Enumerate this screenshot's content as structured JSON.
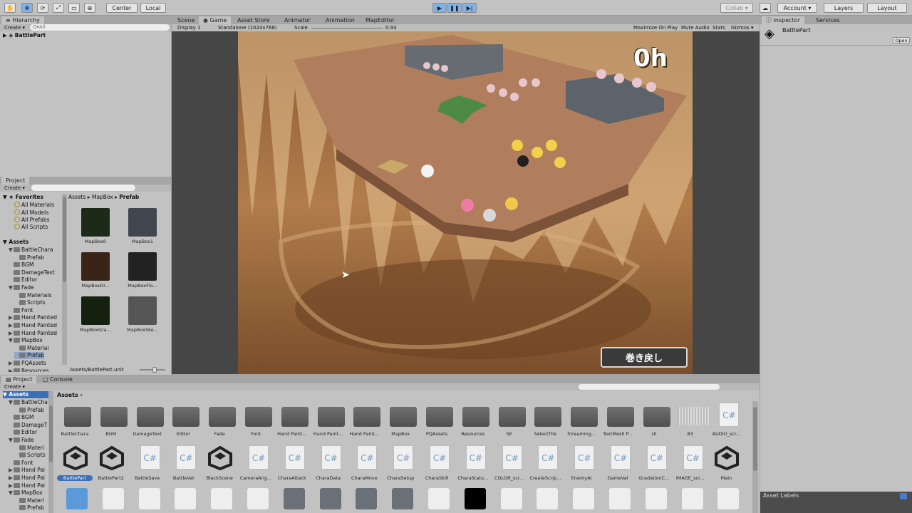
{
  "toolbar": {
    "pivot_center": "Center",
    "pivot_local": "Local",
    "collab": "Collab ▾",
    "account": "Account ▾",
    "layers": "Layers",
    "layout": "Layout"
  },
  "hierarchy": {
    "tab": "Hierarchy",
    "create": "Create ▾",
    "search_placeholder": "Q▾All",
    "root": "BattlePart"
  },
  "scene_tabs": {
    "scene": "Scene",
    "game": "Game",
    "asset_store": "Asset Store",
    "animator": "Animator",
    "animation": "Animation",
    "map_editor": "MapEditor"
  },
  "game_bar": {
    "display": "Display 1",
    "resolution": "Standalone (1024x768)",
    "scale_label": "Scale",
    "scale_value": "0.93",
    "maximize": "Maximize On Play",
    "mute": "Mute Audio",
    "stats": "Stats",
    "gizmos": "Gizmos ▾"
  },
  "game": {
    "hud_timer": "0h",
    "rewind_button": "巻き戻し"
  },
  "inspector": {
    "tab": "Inspector",
    "services": "Services",
    "object": "BattlePart",
    "open": "Open",
    "asset_labels": "Asset Labels"
  },
  "project_top": {
    "tab": "Project",
    "create": "Create ▾",
    "favorites": "Favorites",
    "fav_items": [
      "All Materials",
      "All Models",
      "All Prefabs",
      "All Scripts"
    ],
    "assets": "Assets",
    "tree": [
      {
        "label": "BattleChara",
        "indent": 1,
        "arrow": "▼"
      },
      {
        "label": "Prefab",
        "indent": 2,
        "arrow": ""
      },
      {
        "label": "BGM",
        "indent": 1,
        "arrow": ""
      },
      {
        "label": "DamageText",
        "indent": 1,
        "arrow": ""
      },
      {
        "label": "Editor",
        "indent": 1,
        "arrow": ""
      },
      {
        "label": "Fade",
        "indent": 1,
        "arrow": "▼"
      },
      {
        "label": "Materials",
        "indent": 2,
        "arrow": ""
      },
      {
        "label": "Scripts",
        "indent": 2,
        "arrow": ""
      },
      {
        "label": "Font",
        "indent": 1,
        "arrow": ""
      },
      {
        "label": "Hand Painted",
        "indent": 1,
        "arrow": "▶"
      },
      {
        "label": "Hand Painted",
        "indent": 1,
        "arrow": "▶"
      },
      {
        "label": "Hand Painted",
        "indent": 1,
        "arrow": "▶"
      },
      {
        "label": "MapBox",
        "indent": 1,
        "arrow": "▼"
      },
      {
        "label": "Material",
        "indent": 2,
        "arrow": ""
      },
      {
        "label": "Prefab",
        "indent": 2,
        "arrow": ""
      },
      {
        "label": "PQAssets",
        "indent": 1,
        "arrow": "▶"
      },
      {
        "label": "Resources",
        "indent": 1,
        "arrow": "▶"
      }
    ],
    "breadcrumb": [
      "Assets",
      "MapBox",
      "Prefab"
    ],
    "items": [
      "MapBox0",
      "MapBox1",
      "MapBoxDr...",
      "MapBoxFlo...",
      "MapBoxGra...",
      "MapBoxSke..."
    ],
    "footer": "Assets/BattlePart.unit"
  },
  "project_bottom": {
    "tab": "Project",
    "console": "Console",
    "create": "Create ▾",
    "assets": "Assets",
    "breadcrumb": "Assets ›",
    "tree": [
      "BattleCha",
      "Prefab",
      "BGM",
      "DamageT",
      "Editor",
      "Fade",
      "Materi",
      "Scripts",
      "Font",
      "Hand Pai",
      "Hand Pai",
      "Hand Pai",
      "MapBox",
      "Materi",
      "Prefab"
    ],
    "row1": [
      "BattleChara",
      "BGM",
      "DamageText",
      "Editor",
      "Fade",
      "Font",
      "Hand Paint...",
      "Hand Paint...",
      "Hand Paint...",
      "MapBox",
      "PQAssets",
      "Resources",
      "SE",
      "SelectTile",
      "Streaming...",
      "TextMesh P...",
      "UI",
      "83",
      "AUDIO_scr..."
    ],
    "row2": [
      "BattlePart",
      "BattlePart2",
      "BattleSave",
      "BattleVal",
      "BlackScene",
      "CameraAng...",
      "CharaAttack",
      "CharaData",
      "CharaMove",
      "CharaSetup",
      "CharaSkill",
      "CharaStatu...",
      "COLOR_scr...",
      "CreateScrip...",
      "EnemyAI",
      "GameVal",
      "GradationC...",
      "IMAGE_scr...",
      "Main"
    ]
  }
}
